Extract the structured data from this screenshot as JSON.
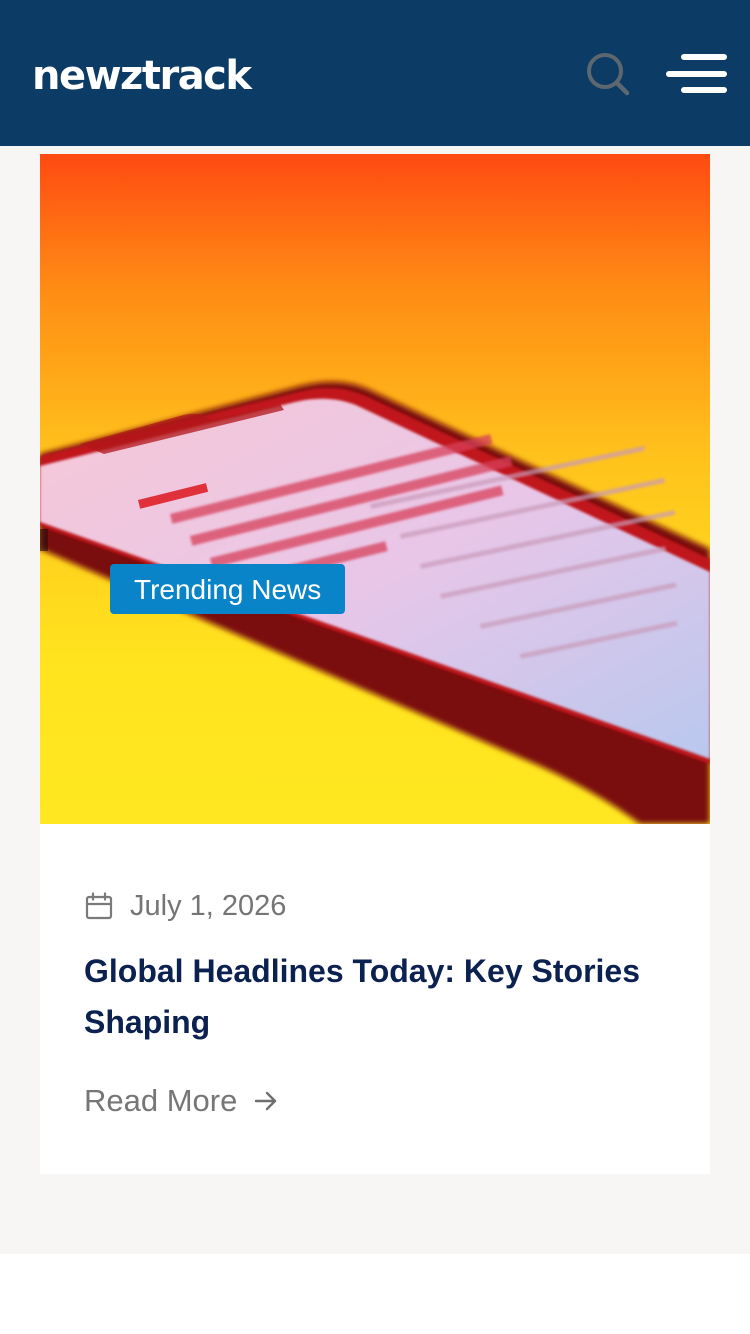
{
  "header": {
    "logo_text": "newztrack",
    "background": "#0c3b65",
    "search_icon": "search-icon",
    "menu_icon": "hamburger-menu-icon"
  },
  "article": {
    "category_badge": "Trending News",
    "badge_color": "#0a84c8",
    "date_icon": "calendar-icon",
    "date": "July 1, 2026",
    "title": "Global Headlines Today: Key Stories Shaping",
    "title_color": "#0b2150",
    "read_more_label": "Read More",
    "read_more_icon": "arrow-right-icon"
  }
}
